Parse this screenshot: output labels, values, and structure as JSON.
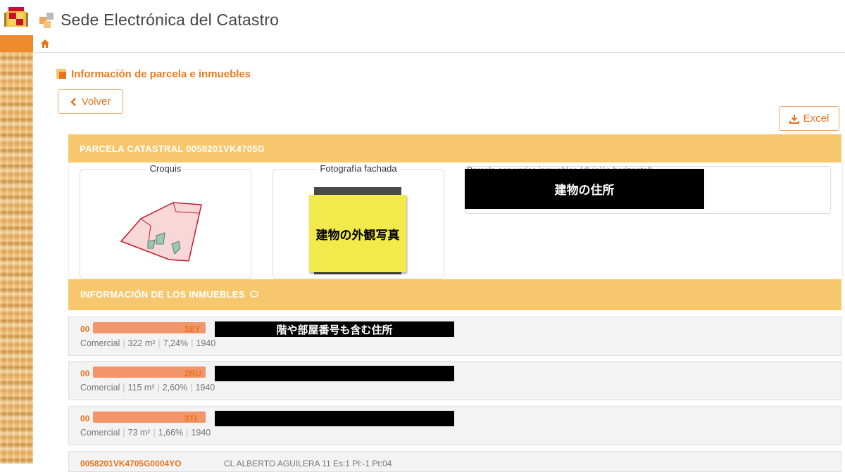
{
  "header": {
    "title": "Sede Electrónica del Catastro"
  },
  "breadcrumb": {
    "home_icon": "home-icon"
  },
  "section": {
    "title": "Información de parcela e inmuebles"
  },
  "buttons": {
    "volver": "Volver",
    "excel": "Excel"
  },
  "parcela": {
    "header": "PARCELA CATASTRAL 0058201VK4705G",
    "croquis_label": "Croquis",
    "fachada_label": "Fotografía fachada",
    "photo_note": "建物の外観写真",
    "address_redaction": "建物の住所",
    "address_faded": "Parcela con varios inmuebles (división horizontal)"
  },
  "inmuebles": {
    "header": "INFORMACIÓN DE LOS INMUEBLES",
    "rows": [
      {
        "ref_prefix": "00",
        "ref_suffix": "1EY",
        "address_redaction": "階や部屋番号も含む住所",
        "use": "Comercial",
        "area": "322 m²",
        "pct": "7,24%",
        "year": "1940"
      },
      {
        "ref_prefix": "00",
        "ref_suffix": "2RU",
        "address_redaction": "",
        "use": "Comercial",
        "area": "115 m²",
        "pct": "2,60%",
        "year": "1940"
      },
      {
        "ref_prefix": "00",
        "ref_suffix": "3TI",
        "address_redaction": "",
        "use": "Comercial",
        "area": "73 m²",
        "pct": "1,66%",
        "year": "1940"
      },
      {
        "ref": "0058201VK4705G0004YO",
        "address": "CL ALBERTO AGUILERA 11 Es:1 Pl:-1 Pt:04"
      }
    ]
  },
  "colors": {
    "accent": "#e8731c",
    "panel": "#f7c76d",
    "redaction": "#000000",
    "note": "#f2ea4a"
  }
}
